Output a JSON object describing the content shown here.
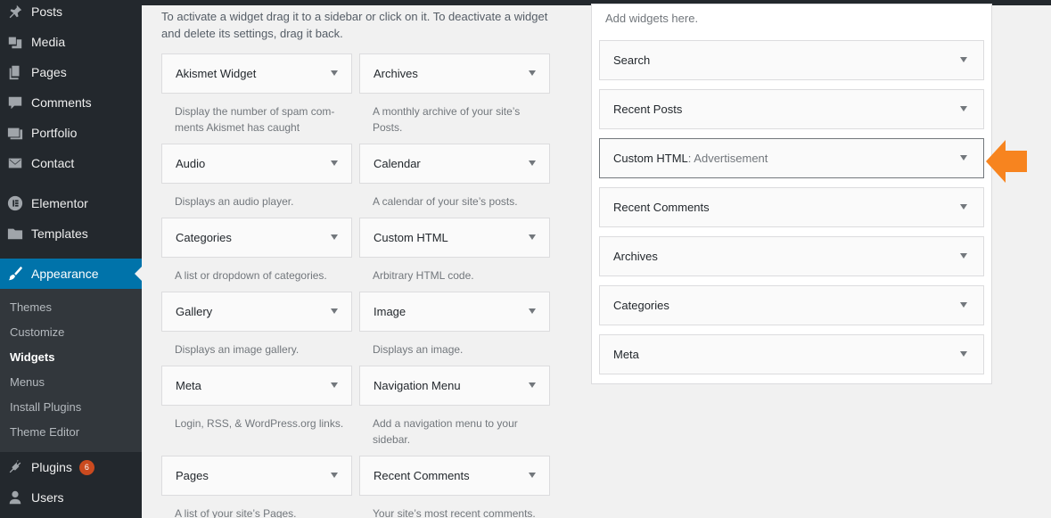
{
  "admin_menu": {
    "items": [
      {
        "label": "Posts",
        "icon": "pin-icon"
      },
      {
        "label": "Media",
        "icon": "media-icon"
      },
      {
        "label": "Pages",
        "icon": "pages-icon"
      },
      {
        "label": "Comments",
        "icon": "comments-icon"
      },
      {
        "label": "Portfolio",
        "icon": "portfolio-icon"
      },
      {
        "label": "Contact",
        "icon": "envelope-icon"
      },
      {
        "label": "Elementor",
        "icon": "elementor-icon"
      },
      {
        "label": "Templates",
        "icon": "folder-icon"
      },
      {
        "label": "Appearance",
        "icon": "paintbrush-icon"
      },
      {
        "label": "Plugins",
        "icon": "plug-icon",
        "badge": "6"
      },
      {
        "label": "Users",
        "icon": "user-icon"
      }
    ],
    "appearance_submenu": [
      "Themes",
      "Customize",
      "Widgets",
      "Menus",
      "Install Plugins",
      "Theme Editor"
    ],
    "active_submenu": "Widgets"
  },
  "available_widgets": {
    "description": "To activate a widget drag it to a sidebar or click on it. To deactivate a widget and delete its settings, drag it back.",
    "widgets": [
      {
        "title": "Akismet Widget",
        "description": "Display the number of spam com- ments Akismet has caught"
      },
      {
        "title": "Archives",
        "description": "A monthly archive of your site’s Posts."
      },
      {
        "title": "Audio",
        "description": "Displays an audio player."
      },
      {
        "title": "Calendar",
        "description": "A calendar of your site’s posts."
      },
      {
        "title": "Categories",
        "description": "A list or dropdown of categories."
      },
      {
        "title": "Custom HTML",
        "description": "Arbitrary HTML code."
      },
      {
        "title": "Gallery",
        "description": "Displays an image gallery."
      },
      {
        "title": "Image",
        "description": "Displays an image."
      },
      {
        "title": "Meta",
        "description": "Login, RSS, & WordPress.org links."
      },
      {
        "title": "Navigation Menu",
        "description": "Add a navigation menu to your sidebar."
      },
      {
        "title": "Pages",
        "description": "A list of your site’s Pages."
      },
      {
        "title": "Recent Comments",
        "description": "Your site’s most recent comments."
      }
    ]
  },
  "sidebar": {
    "hint": "Add widgets here.",
    "widgets": [
      {
        "title": "Search",
        "instance_title": ""
      },
      {
        "title": "Recent Posts",
        "instance_title": ""
      },
      {
        "title": "Custom HTML",
        "instance_title": ": Advertisement"
      },
      {
        "title": "Recent Comments",
        "instance_title": ""
      },
      {
        "title": "Archives",
        "instance_title": ""
      },
      {
        "title": "Categories",
        "instance_title": ""
      },
      {
        "title": "Meta",
        "instance_title": ""
      }
    ]
  },
  "colors": {
    "accent": "#0073aa",
    "admin_bg": "#23282d",
    "pointer_arrow": "#f7841f",
    "badge": "#ca4a1f"
  }
}
